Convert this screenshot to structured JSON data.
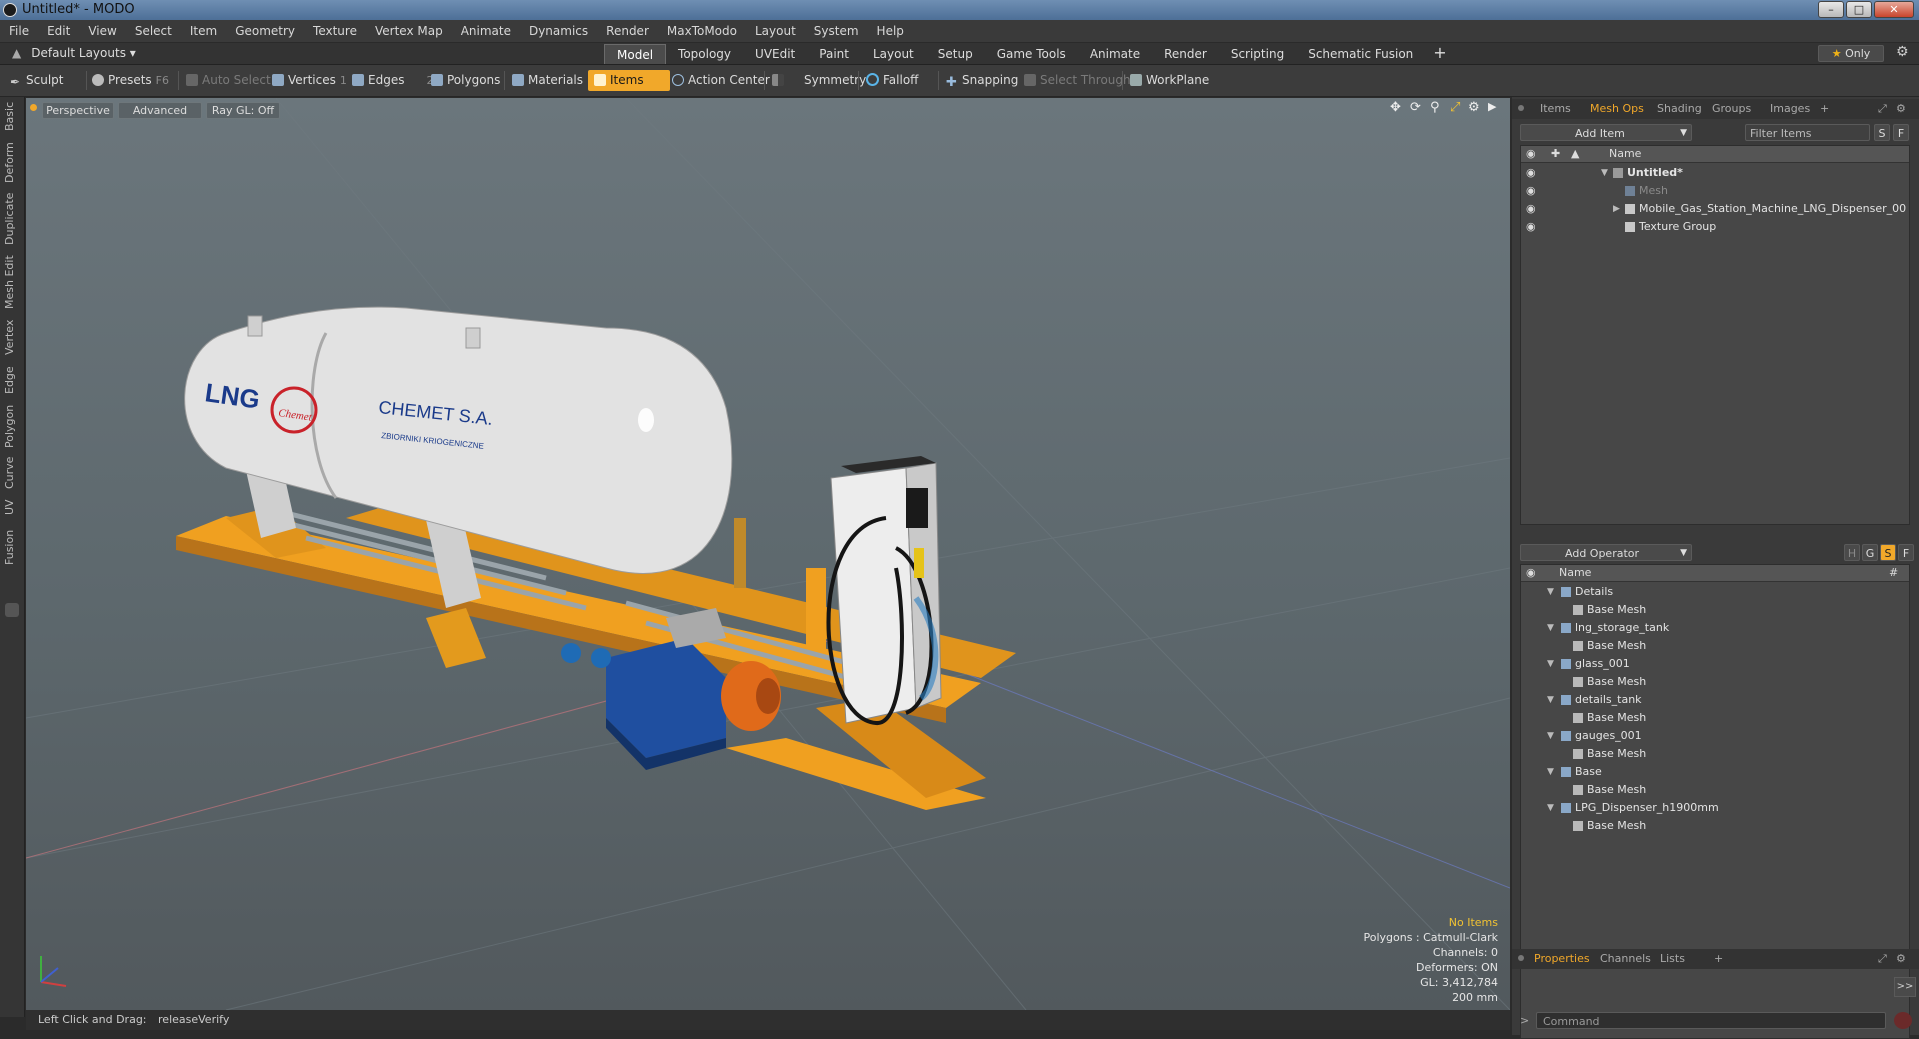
{
  "window": {
    "title": "Untitled* - MODO"
  },
  "menu": [
    "File",
    "Edit",
    "View",
    "Select",
    "Item",
    "Geometry",
    "Texture",
    "Vertex Map",
    "Animate",
    "Dynamics",
    "Render",
    "MaxToModo",
    "Layout",
    "System",
    "Help"
  ],
  "layout_selector": "Default Layouts ▾",
  "tabs": [
    "Model",
    "Topology",
    "UVEdit",
    "Paint",
    "Layout",
    "Setup",
    "Game Tools",
    "Animate",
    "Render",
    "Scripting",
    "Schematic Fusion"
  ],
  "active_tab": "Model",
  "only_label": "Only",
  "toolbar": {
    "sculpt": "Sculpt",
    "presets": "Presets",
    "presets_key": "F6",
    "auto_select": "Auto Select",
    "vertices": "Vertices",
    "vertices_key": "1",
    "edges": "Edges",
    "edges_key": "2",
    "polygons": "Polygons",
    "materials": "Materials",
    "items": "Items",
    "action_center": "Action Center",
    "symmetry": "Symmetry",
    "falloff": "Falloff",
    "snapping": "Snapping",
    "select_through": "Select Through",
    "workplane": "WorkPlane"
  },
  "left_tabs": [
    "Basic",
    "Deform",
    "Duplicate",
    "Mesh Edit",
    "Vertex",
    "Edge",
    "Polygon",
    "Curve",
    "UV",
    "Fusion"
  ],
  "viewport": {
    "view": "Perspective",
    "advanced": "Advanced",
    "raygl": "Ray GL: Off",
    "hud": {
      "items": "No Items",
      "polygons": "Polygons : Catmull-Clark",
      "channels": "Channels: 0",
      "deformers": "Deformers: ON",
      "gl": "GL: 3,412,784",
      "scale": "200 mm"
    },
    "model_text": {
      "lng": "LNG",
      "brand": "Chemet",
      "company": "CHEMET S.A.",
      "subtitle": "ZBIORNIKI KRIOGENICZNE"
    }
  },
  "status": {
    "left": "Left Click and Drag:",
    "right": "releaseVerify"
  },
  "items_panel": {
    "tabs": [
      "Items",
      "Mesh Ops",
      "Shading",
      "Groups",
      "Images"
    ],
    "active_tab": "Mesh Ops",
    "add_item": "Add Item",
    "filter": "Filter Items",
    "s_btn": "S",
    "f_btn": "F",
    "header": "Name",
    "rows": [
      {
        "name": "Untitled*",
        "level": 0,
        "expanded": true,
        "bold": true
      },
      {
        "name": "Mesh",
        "level": 1,
        "dim": true
      },
      {
        "name": "Mobile_Gas_Station_Machine_LNG_Dispenser_00 ...",
        "level": 1,
        "expandable": true
      },
      {
        "name": "Texture Group",
        "level": 1
      }
    ]
  },
  "meshops_panel": {
    "add_operator": "Add Operator",
    "header": "Name",
    "count_header": "#",
    "rows": [
      {
        "name": "Details",
        "level": 0
      },
      {
        "name": "Base Mesh",
        "level": 1
      },
      {
        "name": "lng_storage_tank",
        "level": 0
      },
      {
        "name": "Base Mesh",
        "level": 1
      },
      {
        "name": "glass_001",
        "level": 0
      },
      {
        "name": "Base Mesh",
        "level": 1
      },
      {
        "name": "details_tank",
        "level": 0
      },
      {
        "name": "Base Mesh",
        "level": 1
      },
      {
        "name": "gauges_001",
        "level": 0
      },
      {
        "name": "Base Mesh",
        "level": 1
      },
      {
        "name": "Base",
        "level": 0
      },
      {
        "name": "Base Mesh",
        "level": 1
      },
      {
        "name": "LPG_Dispenser_h1900mm",
        "level": 0
      },
      {
        "name": "Base Mesh",
        "level": 1
      }
    ]
  },
  "properties_panel": {
    "tabs": [
      "Properties",
      "Channels",
      "Lists"
    ],
    "active_tab": "Properties",
    "command_placeholder": "Command"
  },
  "colors": {
    "accent": "#f1a82a",
    "frame": "#f0a020",
    "tank": "#e2e2e2",
    "pump": "#1f4fa0",
    "motor": "#e06a1a"
  }
}
